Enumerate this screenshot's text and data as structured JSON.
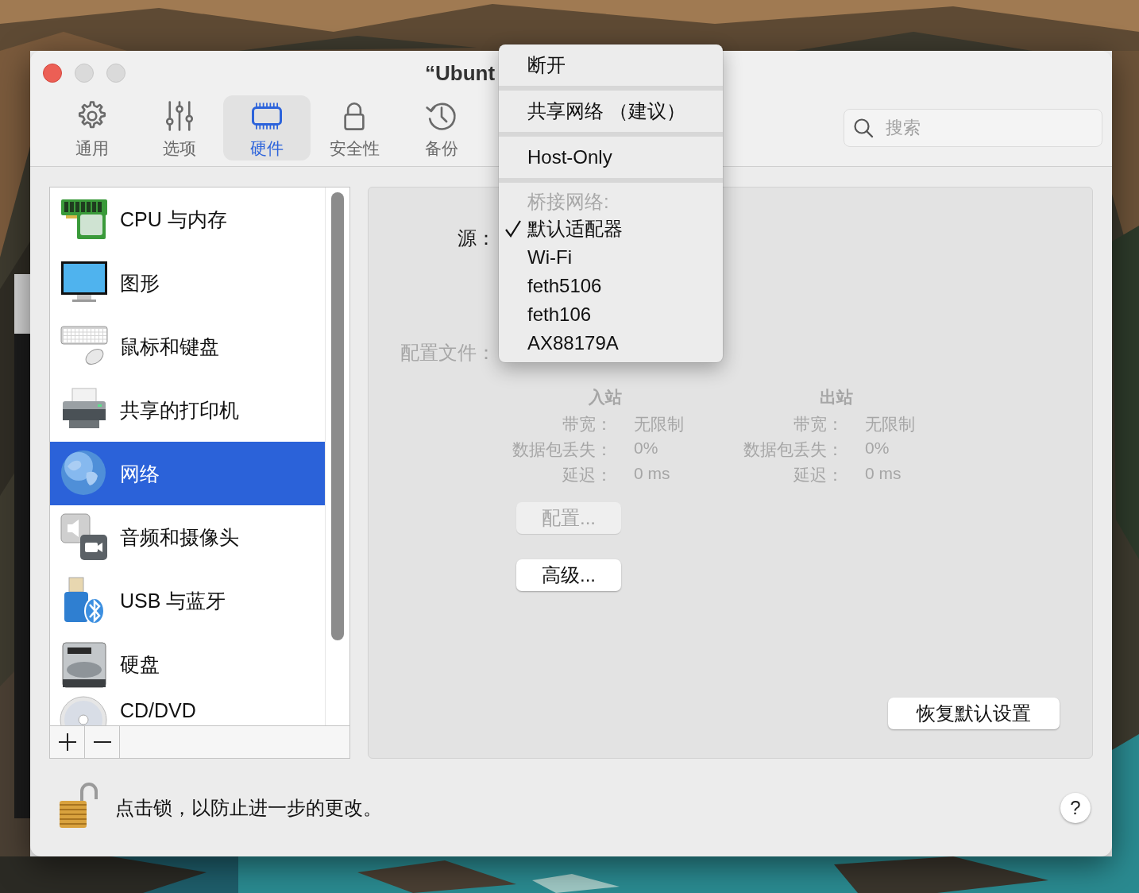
{
  "window": {
    "title": "“Ubunt"
  },
  "toolbar": [
    {
      "label": "通用",
      "selected": false
    },
    {
      "label": "选项",
      "selected": false
    },
    {
      "label": "硬件",
      "selected": true
    },
    {
      "label": "安全性",
      "selected": false
    },
    {
      "label": "备份",
      "selected": false
    }
  ],
  "search": {
    "placeholder": "搜索"
  },
  "sidebar": {
    "items": [
      {
        "label": "CPU 与内存",
        "selected": false
      },
      {
        "label": "图形",
        "selected": false
      },
      {
        "label": "鼠标和键盘",
        "selected": false
      },
      {
        "label": "共享的打印机",
        "selected": false
      },
      {
        "label": "网络",
        "selected": true
      },
      {
        "label": "音频和摄像头",
        "selected": false
      },
      {
        "label": "USB 与蓝牙",
        "selected": false
      },
      {
        "label": "硬盘",
        "selected": false
      },
      {
        "label": "CD/DVD",
        "selected": false
      }
    ]
  },
  "form": [
    {
      "label": "源：",
      "disabled": false
    },
    {
      "label": "配置文件：",
      "disabled": true
    }
  ],
  "traffic": [
    {
      "heading": "入站",
      "disabled": true,
      "rows": [
        {
          "label": "带宽：",
          "value": "无限制"
        },
        {
          "label": "数据包丢失：",
          "value": "0%"
        },
        {
          "label": "延迟：",
          "value": "0 ms"
        }
      ]
    },
    {
      "heading": "出站",
      "disabled": true,
      "rows": [
        {
          "label": "带宽：",
          "value": "无限制"
        },
        {
          "label": "数据包丢失：",
          "value": "0%"
        },
        {
          "label": "延迟：",
          "value": "0 ms"
        }
      ]
    }
  ],
  "buttons": [
    {
      "label": "配置...",
      "disabled": true
    },
    {
      "label": "高级...",
      "disabled": false
    }
  ],
  "restore_button": "恢复默认设置",
  "source_menu": {
    "items": [
      {
        "kind": "item",
        "label": "断开",
        "checked": false
      },
      {
        "kind": "separator"
      },
      {
        "kind": "item",
        "label": "共享网络 （建议）",
        "checked": false
      },
      {
        "kind": "separator"
      },
      {
        "kind": "item",
        "label": "Host-Only",
        "checked": false
      },
      {
        "kind": "separator"
      },
      {
        "kind": "header",
        "label": "桥接网络:"
      },
      {
        "kind": "item",
        "label": "默认适配器",
        "checked": true
      },
      {
        "kind": "item",
        "label": "Wi-Fi",
        "checked": false
      },
      {
        "kind": "item",
        "label": "feth5106",
        "checked": false
      },
      {
        "kind": "item",
        "label": "feth106",
        "checked": false
      },
      {
        "kind": "item",
        "label": "AX88179A",
        "checked": false
      }
    ]
  },
  "footer": {
    "text": "点击锁，以防止进一步的更改。",
    "help": "?"
  }
}
